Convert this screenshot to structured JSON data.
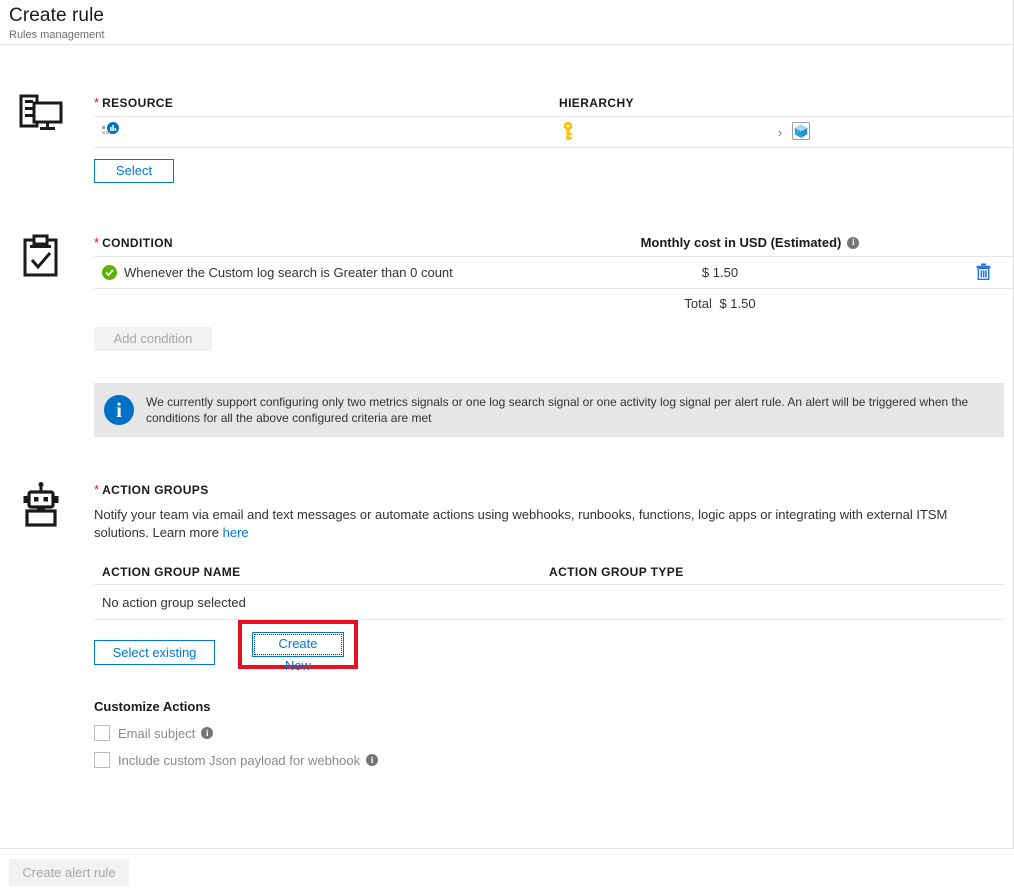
{
  "header": {
    "title": "Create rule",
    "subtitle": "Rules management"
  },
  "resource": {
    "label": "RESOURCE",
    "required_marker": "*",
    "hierarchy_label": "HIERARCHY",
    "row": {
      "resource_icon": "application-insights-icon",
      "subscription_icon": "key-icon",
      "separator": "›",
      "resource_group_icon": "resource-group-cube-icon"
    },
    "select_button": "Select"
  },
  "condition": {
    "label": "CONDITION",
    "required_marker": "*",
    "cost_header": "Monthly cost in USD (Estimated)",
    "cost_info_glyph": "i",
    "rows": [
      {
        "status_icon": "check-circle-icon",
        "text": "Whenever the Custom log search is Greater than 0 count",
        "cost": "$ 1.50",
        "delete_icon": "trash-icon"
      }
    ],
    "total_label": "Total",
    "total_value": "$ 1.50",
    "add_condition_button": "Add condition"
  },
  "info_banner": {
    "icon": "info-circle-icon",
    "glyph": "i",
    "text": "We currently support configuring only two metrics signals or one log search signal or one activity log signal per alert rule. An alert will be triggered when the conditions for all the above configured criteria are met"
  },
  "action_groups": {
    "label": "ACTION GROUPS",
    "required_marker": "*",
    "description": "Notify your team via email and text messages or automate actions using webhooks, runbooks, functions, logic apps or integrating with external ITSM solutions.",
    "learn_more_prefix": "Learn more ",
    "learn_more_link": "here",
    "columns": {
      "name": "ACTION GROUP NAME",
      "type": "ACTION GROUP TYPE"
    },
    "empty_text": "No action group selected",
    "select_existing_button": "Select existing",
    "create_new_button": "Create New"
  },
  "customize_actions": {
    "title": "Customize Actions",
    "checkboxes": [
      {
        "label": "Email subject",
        "checked": false,
        "info_glyph": "i"
      },
      {
        "label": "Include custom Json payload for webhook",
        "checked": false,
        "info_glyph": "i"
      }
    ]
  },
  "footer": {
    "create_alert_rule_button": "Create alert rule"
  },
  "colors": {
    "accent_blue": "#0078d4",
    "required_red": "#e81123",
    "highlight_red": "#e81123",
    "success_green": "#5cb300",
    "info_blue": "#0072c6",
    "banner_gray": "#e6e6e6",
    "disabled_gray": "#a6a6a6",
    "key_yellow": "#ffd000"
  }
}
